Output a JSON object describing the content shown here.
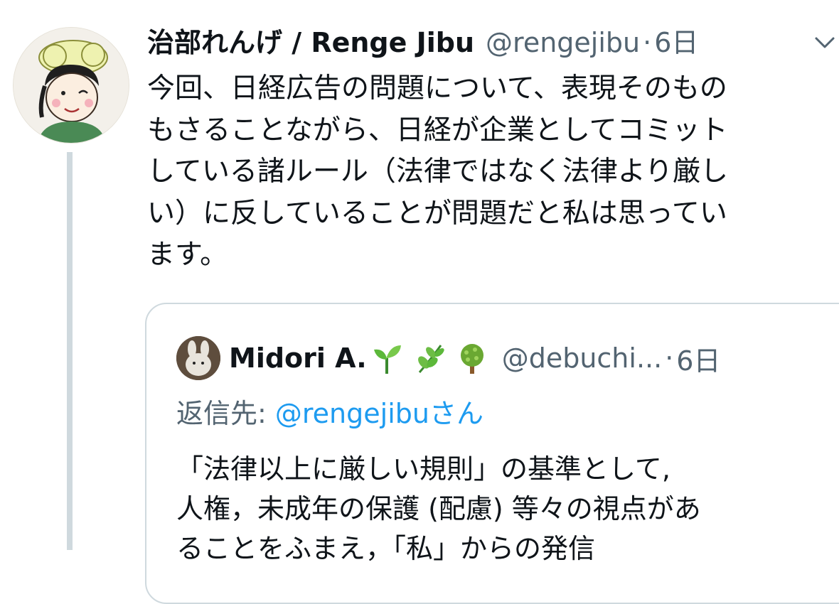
{
  "tweet": {
    "author_name": "治部れんげ / Renge Jibu",
    "handle": "@rengejibu",
    "separator": "·",
    "time": "6日",
    "text_lines": [
      "今回、日経広告の問題について、表現そのもの",
      "もさることながら、日経が企業としてコミット",
      "している諸ルール（法律ではなく法律より厳し",
      "い）に反していることが問題だと私は思ってい",
      "ます。"
    ]
  },
  "quoted_tweet": {
    "author_name": "Midori A.",
    "emoji_icons": [
      "seedling-icon",
      "herb-icon",
      "tree-icon"
    ],
    "handle": "@debuchi...",
    "separator": "·",
    "time": "6日",
    "reply_prefix": "返信先: ",
    "reply_mention": "@rengejibu",
    "reply_suffix": "さん",
    "text_lines": [
      "「法律以上に厳しい規則」の基準として,",
      "人権，未成年の保護 (配慮) 等々の視点があ",
      "ることをふまえ，「私」からの発信"
    ]
  },
  "colors": {
    "text_primary": "#0f1419",
    "text_secondary": "#536471",
    "link": "#1d9bf0",
    "border": "#cfd9de"
  }
}
